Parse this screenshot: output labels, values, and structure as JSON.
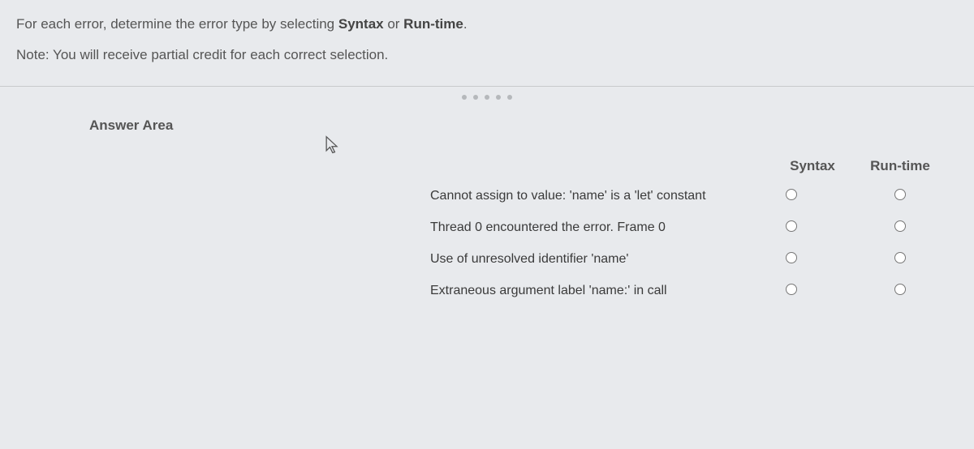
{
  "instructions": {
    "line1_prefix": "For each error, determine the error type by selecting ",
    "line1_bold1": "Syntax",
    "line1_mid": " or ",
    "line1_bold2": "Run-time",
    "line1_suffix": ".",
    "line2": "Note: You will receive partial credit for each correct selection."
  },
  "answer_area_label": "Answer Area",
  "columns": {
    "syntax": "Syntax",
    "runtime": "Run-time"
  },
  "rows": [
    {
      "text": "Cannot assign to value: 'name' is a 'let' constant"
    },
    {
      "text": "Thread 0 encountered the error. Frame 0"
    },
    {
      "text": "Use of unresolved identifier 'name'"
    },
    {
      "text": "Extraneous argument label 'name:' in call"
    }
  ]
}
